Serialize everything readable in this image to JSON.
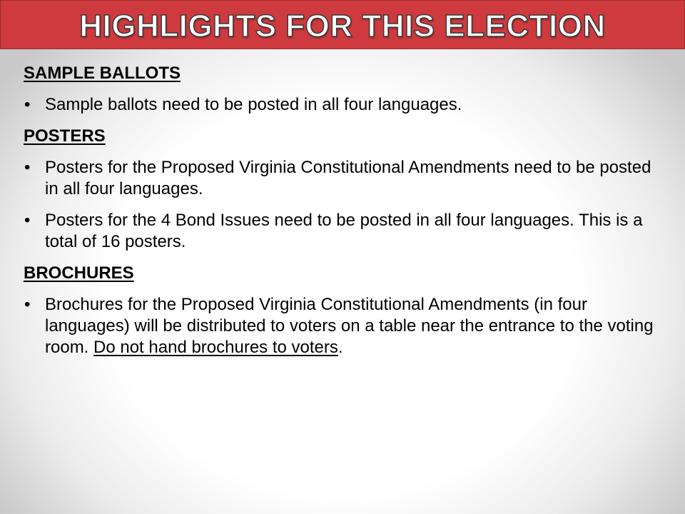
{
  "title": "HIGHLIGHTS FOR THIS ELECTION",
  "bullet_glyph": "•",
  "sections": [
    {
      "heading": "SAMPLE BALLOTS",
      "bullets": [
        {
          "text": "Sample ballots need to be posted in all four languages."
        }
      ]
    },
    {
      "heading": "POSTERS",
      "bullets": [
        {
          "text": "Posters for the Proposed Virginia Constitutional Amendments need to be posted in all four languages."
        },
        {
          "text": "Posters for the 4 Bond Issues need to be posted in all four languages. This is a total of 16 posters."
        }
      ]
    },
    {
      "heading": "BROCHURES",
      "bullets": [
        {
          "text": "Brochures for the Proposed Virginia Constitutional Amendments (in four languages) will be distributed to voters on a table near the entrance to the voting room. ",
          "underlined": "Do not hand brochures to voters",
          "suffix": "."
        }
      ]
    }
  ],
  "colors": {
    "banner": "#cf3a3e",
    "title_text": "#ffffff",
    "body_text": "#000000"
  }
}
